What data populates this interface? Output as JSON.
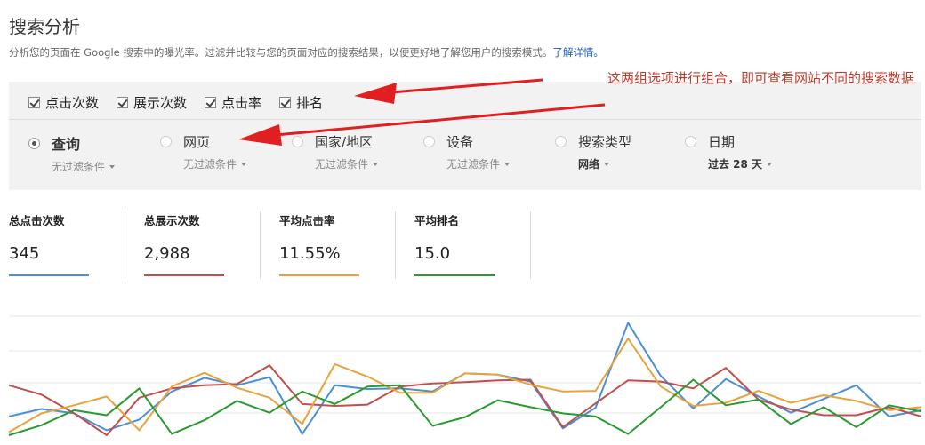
{
  "page": {
    "title": "搜索分析",
    "description": "分析您的页面在 Google 搜索中的曝光率。过滤并比较与您的页面对应的搜索结果，以便更好地了解您用户的搜索模式。",
    "learn_more": "了解详情。"
  },
  "metrics": [
    {
      "label": "点击次数",
      "checked": true
    },
    {
      "label": "展示次数",
      "checked": true
    },
    {
      "label": "点击率",
      "checked": true
    },
    {
      "label": "排名",
      "checked": true
    }
  ],
  "dimensions": [
    {
      "label": "查询",
      "selected": true,
      "filter": "无过滤条件"
    },
    {
      "label": "网页",
      "selected": false,
      "filter": "无过滤条件"
    },
    {
      "label": "国家/地区",
      "selected": false,
      "filter": "无过滤条件"
    },
    {
      "label": "设备",
      "selected": false,
      "filter": "无过滤条件"
    },
    {
      "label": "搜索类型",
      "selected": false,
      "filter": "网络"
    },
    {
      "label": "日期",
      "selected": false,
      "filter": "过去 28 天"
    }
  ],
  "annotation": "这两组选项进行组合，即可查看网站不同的搜索数据",
  "summary": [
    {
      "label": "总点击次数",
      "value": "345",
      "color": "#4a90d9"
    },
    {
      "label": "总展示次数",
      "value": "2,988",
      "color": "#c0504d"
    },
    {
      "label": "平均点击率",
      "value": "11.55%",
      "color": "#e8a33c"
    },
    {
      "label": "平均排名",
      "value": "15.0",
      "color": "#2a9a32"
    }
  ],
  "chart_data": {
    "type": "line",
    "x": [
      1,
      2,
      3,
      4,
      5,
      6,
      7,
      8,
      9,
      10,
      11,
      12,
      13,
      14,
      15,
      16,
      17,
      18,
      19,
      20,
      21,
      22,
      23,
      24,
      25,
      26,
      27,
      28,
      29
    ],
    "series": [
      {
        "color": "#4a90d9",
        "values": [
          30,
          42,
          35,
          8,
          25,
          70,
          92,
          80,
          93,
          2,
          80,
          74,
          75,
          70,
          99,
          97,
          86,
          11,
          44,
          180,
          95,
          43,
          90,
          62,
          36,
          58,
          80,
          30,
          40
        ]
      },
      {
        "color": "#c0504d",
        "values": [
          80,
          65,
          35,
          0,
          60,
          75,
          80,
          82,
          112,
          50,
          47,
          49,
          78,
          83,
          85,
          88,
          89,
          13,
          51,
          88,
          86,
          75,
          108,
          57,
          41,
          32,
          32,
          45,
          30
        ]
      },
      {
        "color": "#e8a33c",
        "values": [
          5,
          35,
          48,
          62,
          8,
          78,
          100,
          76,
          60,
          18,
          114,
          94,
          68,
          68,
          99,
          97,
          81,
          70,
          71,
          155,
          78,
          47,
          52,
          71,
          52,
          64,
          55,
          40,
          45
        ]
      },
      {
        "color": "#2a9a32",
        "values": [
          0,
          16,
          40,
          32,
          75,
          2,
          24,
          55,
          36,
          70,
          50,
          78,
          80,
          15,
          29,
          56,
          45,
          35,
          30,
          2,
          45,
          89,
          48,
          57,
          18,
          45,
          13,
          48,
          38
        ]
      }
    ],
    "grid": true
  }
}
